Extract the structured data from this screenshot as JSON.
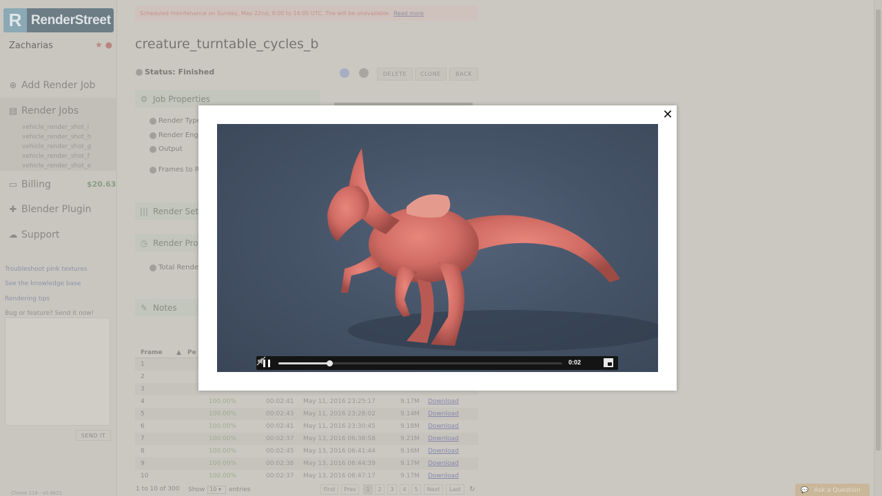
{
  "app": {
    "logo_mark": "R",
    "logo_text": "RenderStreet",
    "username": "Zacharias"
  },
  "sidebar": {
    "add_job": "Add Render Job",
    "render_jobs": "Render Jobs",
    "jobs": [
      "vehicle_render_shot_i",
      "vehicle_render_shot_h",
      "vehicle_render_shot_g",
      "vehicle_render_shot_f",
      "vehicle_render_shot_e"
    ],
    "billing": "Billing",
    "billing_amount": "$20.63",
    "blender_plugin": "Blender Plugin",
    "support": "Support",
    "links": [
      "Troubleshoot pink textures",
      "See the knowledge base",
      "Rendering tips"
    ],
    "feedback_prompt": "Bug or feature? Send it now!",
    "send_label": "SEND IT",
    "footer": "Chroot 118 · v0.9621"
  },
  "banner": {
    "text": "Scheduled maintenance on Sunday, May 22nd, 9:00 to 14:00 UTC. The will be unavailable.",
    "read_more": "Read more"
  },
  "job": {
    "title": "creature_turntable_cycles_b",
    "status": "Status: Finished",
    "buttons": {
      "delete": "DELETE",
      "clone": "CLONE",
      "back": "BACK"
    },
    "panels": {
      "properties": "Job Properties",
      "render_settings": "Render Set",
      "render_progress": "Render Pro",
      "notes": "Notes"
    },
    "props": [
      "Render Type",
      "Render Engi",
      "Output",
      "Frames to R"
    ],
    "total_render": "Total Rende"
  },
  "table": {
    "headers": {
      "frame": "Frame",
      "percent": "Pe"
    },
    "rows": [
      {
        "frame": "1",
        "pct": "",
        "time": "",
        "date": "",
        "size": "",
        "dl": ""
      },
      {
        "frame": "2",
        "pct": "",
        "time": "",
        "date": "",
        "size": "",
        "dl": ""
      },
      {
        "frame": "3",
        "pct": "",
        "time": "",
        "date": "",
        "size": "",
        "dl": ""
      },
      {
        "frame": "4",
        "pct": "100.00%",
        "time": "00:02:41",
        "date": "May 11, 2016 23:25:17",
        "size": "9.17M",
        "dl": "Download"
      },
      {
        "frame": "5",
        "pct": "100.00%",
        "time": "00:02:43",
        "date": "May 11, 2016 23:28:02",
        "size": "9.14M",
        "dl": "Download"
      },
      {
        "frame": "6",
        "pct": "100.00%",
        "time": "00:02:41",
        "date": "May 11, 2016 23:30:45",
        "size": "9.18M",
        "dl": "Download"
      },
      {
        "frame": "7",
        "pct": "100.00%",
        "time": "00:02:37",
        "date": "May 13, 2016 06:38:58",
        "size": "9.21M",
        "dl": "Download"
      },
      {
        "frame": "8",
        "pct": "100.00%",
        "time": "00:02:45",
        "date": "May 13, 2016 06:41:44",
        "size": "9.16M",
        "dl": "Download"
      },
      {
        "frame": "9",
        "pct": "100.00%",
        "time": "00:02:38",
        "date": "May 13, 2016 06:44:39",
        "size": "9.17M",
        "dl": "Download"
      },
      {
        "frame": "10",
        "pct": "100.00%",
        "time": "00:02:37",
        "date": "May 13, 2016 06:47:17",
        "size": "9.17M",
        "dl": "Download"
      }
    ],
    "summary": "1 to 10 of 300",
    "show": "Show",
    "page_size": "10",
    "entries": "entries",
    "pager": {
      "first": "First",
      "prev": "Prev",
      "pages": [
        "1",
        "2",
        "3",
        "4",
        "5"
      ],
      "next": "Next",
      "last": "Last"
    }
  },
  "ask": "Ask a Question",
  "video": {
    "time": "0:02",
    "progress": 0.18,
    "state": "playing"
  },
  "colors": {
    "accent": "#6d7d86",
    "modal_bg": "#ffffff",
    "video_bg": "#465468",
    "creature": "#d9736b"
  }
}
